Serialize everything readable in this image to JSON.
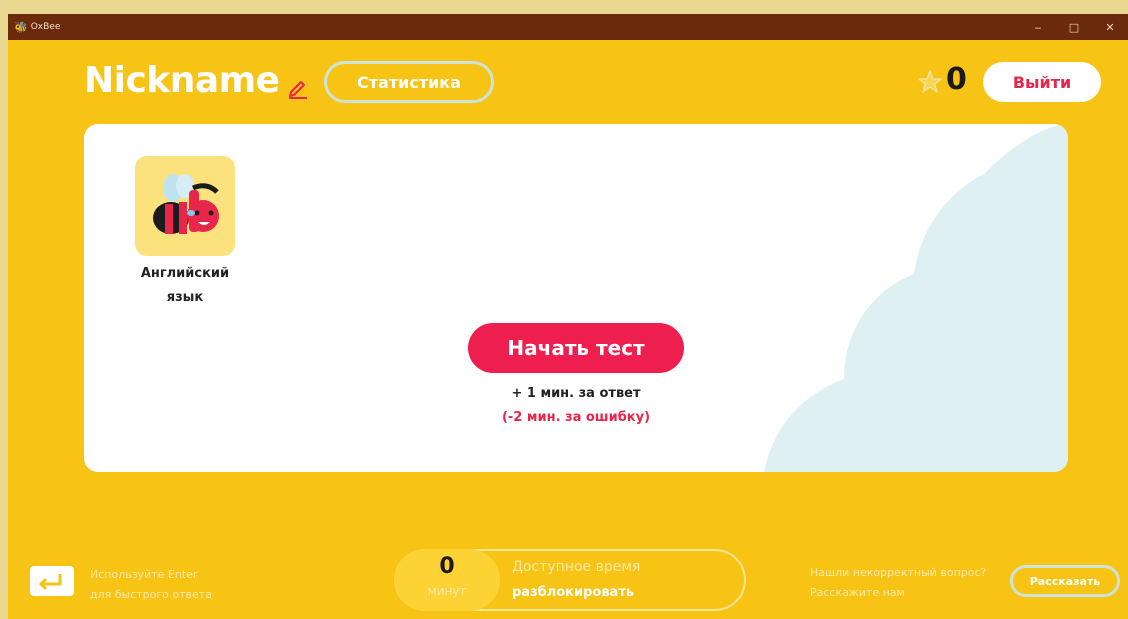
{
  "window": {
    "title": "OxBee",
    "icon": "bee-icon",
    "controls": {
      "minimize": "‒",
      "maximize": "□",
      "close": "✕"
    }
  },
  "header": {
    "nickname": "Nickname",
    "stats_label": "Статистика",
    "score": "0",
    "logout_label": "Выйти"
  },
  "course": {
    "label_line1": "Английский",
    "label_line2": "язык"
  },
  "main": {
    "start_label": "Начать тест",
    "bonus_text": "+ 1 мин. за ответ",
    "penalty_text": "(-2 мин. за ошибку)"
  },
  "footer": {
    "hint_line1": "Используйте Enter",
    "hint_line2": "для быстрого ответа",
    "time_value": "0",
    "time_unit": "минут",
    "time_title": "Доступное время",
    "unlock_label": "разблокировать",
    "report_line1": "Нашли некорректный вопрос?",
    "report_line2": "Расскажите нам",
    "report_button": "Рассказать"
  },
  "colors": {
    "background": "#f7c315",
    "titlebar": "#6b2a0c",
    "accent": "#ee1f4e",
    "card": "#ffffff",
    "cloud": "#dff0f2"
  }
}
